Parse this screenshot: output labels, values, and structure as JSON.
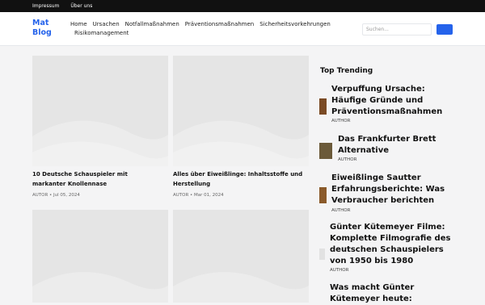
{
  "topbar": {
    "links": [
      "Impressum",
      "Über uns"
    ]
  },
  "header": {
    "logo": "Mat Blog",
    "nav": [
      "Home",
      "Ursachen",
      "Notfallmaßnahmen",
      "Präventionsmaßnahmen",
      "Sicherheitsvorkehrungen",
      "Risikomanagement"
    ],
    "search_placeholder": "Suchen..."
  },
  "colors": {
    "accent": "#2563eb",
    "topbar": "#111111",
    "placeholder": "#e5e5e5"
  },
  "posts": [
    {
      "title": "10 Deutsche Schauspieler mit markanter Knollennase",
      "meta": "AUTOR • Jul 05, 2024"
    },
    {
      "title": "Alles über Eiweißlinge: Inhaltsstoffe und Herstellung",
      "meta": "AUTOR • Mar 01, 2024"
    },
    {
      "title": "",
      "meta": ""
    },
    {
      "title": "",
      "meta": ""
    }
  ],
  "sidebar": {
    "heading": "Top Trending",
    "items": [
      {
        "title": "Verpuffung Ursache: Häufige Gründe und Präventionsmaßnahmen",
        "meta": "AUTHOR"
      },
      {
        "title": "Das Frankfurter Brett Alternative",
        "meta": "AUTHOR"
      },
      {
        "title": "Eiweißlinge Sautter Erfahrungsberichte: Was Verbraucher berichten",
        "meta": "AUTHOR"
      },
      {
        "title": "Günter Kütemeyer Filme: Komplette Filmografie des deutschen Schauspielers von 1950 bis 1980",
        "meta": "AUTHOR"
      },
      {
        "title": "Was macht Günter Kütemeyer heute:",
        "meta": ""
      }
    ]
  }
}
